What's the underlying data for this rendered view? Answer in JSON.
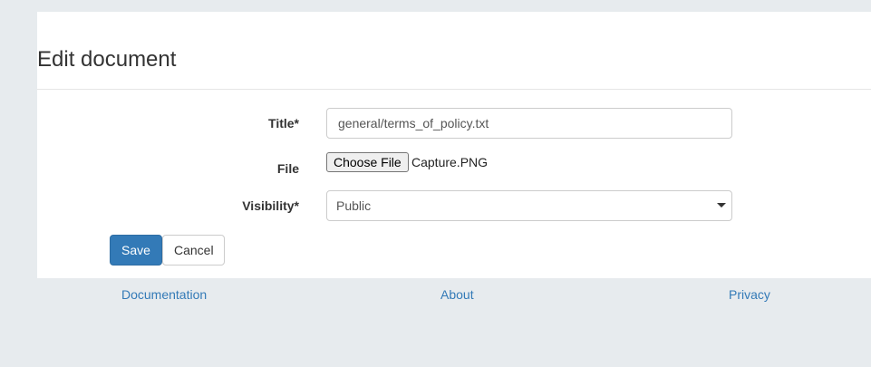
{
  "page": {
    "title": "Edit document"
  },
  "form": {
    "title_label": "Title*",
    "title_value": "general/terms_of_policy.txt",
    "file_label": "File",
    "file_button_label": "Choose File",
    "file_name": "Capture.PNG",
    "visibility_label": "Visibility*",
    "visibility_selected": "Public"
  },
  "actions": {
    "save_label": "Save",
    "cancel_label": "Cancel"
  },
  "footer": {
    "links": [
      "Documentation",
      "About",
      "Privacy"
    ]
  },
  "colors": {
    "background": "#e7ebee",
    "primary": "#337ab7",
    "link": "#337ab7"
  }
}
